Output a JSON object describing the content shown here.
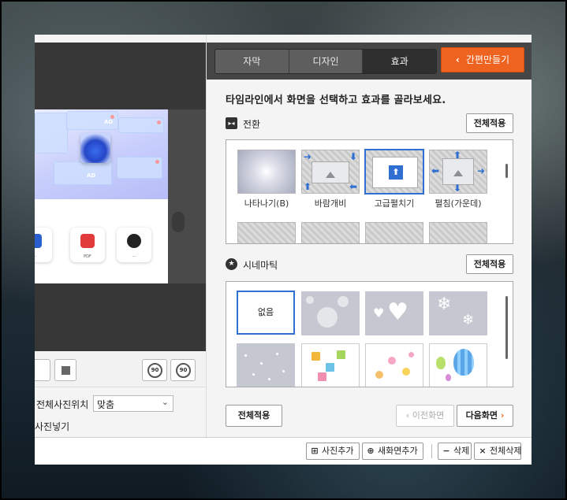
{
  "tabs": [
    {
      "label": "자막",
      "active": false
    },
    {
      "label": "디자인",
      "active": false
    },
    {
      "label": "효과",
      "active": true
    }
  ],
  "quick_make_label": "간편만들기",
  "instruction": "타임라인에서 화면을 선택하고 효과를 골라보세요.",
  "transition": {
    "title": "전환",
    "apply_all_label": "전체적용",
    "items": [
      {
        "label": "나타나기(B)",
        "icon": "fade-in-thumbnail",
        "selected": false
      },
      {
        "label": "바람개비",
        "icon": "pinwheel-thumbnail",
        "selected": false
      },
      {
        "label": "고급펼치기",
        "icon": "advanced-unfold-thumbnail",
        "selected": true
      },
      {
        "label": "펼침(가운데)",
        "icon": "unfold-center-thumbnail",
        "selected": false
      }
    ]
  },
  "cinematic": {
    "title": "시네마틱",
    "apply_all_label": "전체적용",
    "items": [
      {
        "label": "없음",
        "selected": true
      },
      {
        "icon": "bubbles-thumbnail"
      },
      {
        "icon": "hearts-thumbnail"
      },
      {
        "icon": "snowflakes-thumbnail"
      },
      {
        "icon": "dots-thumbnail"
      },
      {
        "icon": "gifts-thumbnail"
      },
      {
        "icon": "flowers-thumbnail"
      },
      {
        "icon": "balloons-thumbnail"
      }
    ]
  },
  "footer": {
    "apply_all_label": "전체적용",
    "prev_label": "이전화면",
    "next_label": "다음화면"
  },
  "left": {
    "position_label": "전체사진위치",
    "position_value": "맞춤",
    "insert_label": "사진넣기",
    "rotate_left": "90",
    "rotate_right": "90"
  },
  "bottom": {
    "add_photo": "사진추가",
    "new_screen": "새화면추가",
    "delete": "삭제",
    "delete_all": "전체삭제"
  },
  "colors": {
    "accent": "#ef6321",
    "selection": "#2f6fd2",
    "tab_active": "#2f2f2f"
  }
}
